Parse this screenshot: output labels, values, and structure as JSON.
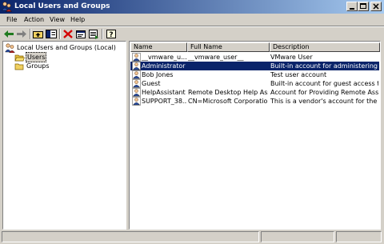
{
  "window": {
    "title": "Local Users and Groups"
  },
  "menu": [
    "File",
    "Action",
    "View",
    "Help"
  ],
  "toolbar": [
    "back-icon",
    "forward-icon",
    "up-level-icon",
    "show-hide-tree-icon",
    "delete-icon",
    "properties-icon",
    "export-list-icon",
    "help-icon"
  ],
  "tree": {
    "root": "Local Users and Groups (Local)",
    "items": [
      "Users",
      "Groups"
    ]
  },
  "list": {
    "columns": [
      "Name",
      "Full Name",
      "Description"
    ],
    "rows": [
      {
        "name": "__vmware_u...",
        "full_name": "__vmware_user__",
        "description": "VMware User",
        "selected": false
      },
      {
        "name": "Administrator",
        "full_name": "",
        "description": "Built-in account for administering the...",
        "selected": true
      },
      {
        "name": "Bob Jones",
        "full_name": "",
        "description": "Test user account",
        "selected": false
      },
      {
        "name": "Guest",
        "full_name": "",
        "description": "Built-in account for guest access to t...",
        "selected": false
      },
      {
        "name": "HelpAssistant",
        "full_name": "Remote Desktop Help Assi...",
        "description": "Account for Providing Remote Assist...",
        "selected": false
      },
      {
        "name": "SUPPORT_38...",
        "full_name": "CN=Microsoft Corporation...",
        "description": "This is a vendor's account for the He...",
        "selected": false
      }
    ]
  },
  "colors": {
    "title_active": "#0a246a",
    "title_gradient_end": "#a6caf0",
    "selection": "#0a246a",
    "face": "#d4d0c8"
  }
}
